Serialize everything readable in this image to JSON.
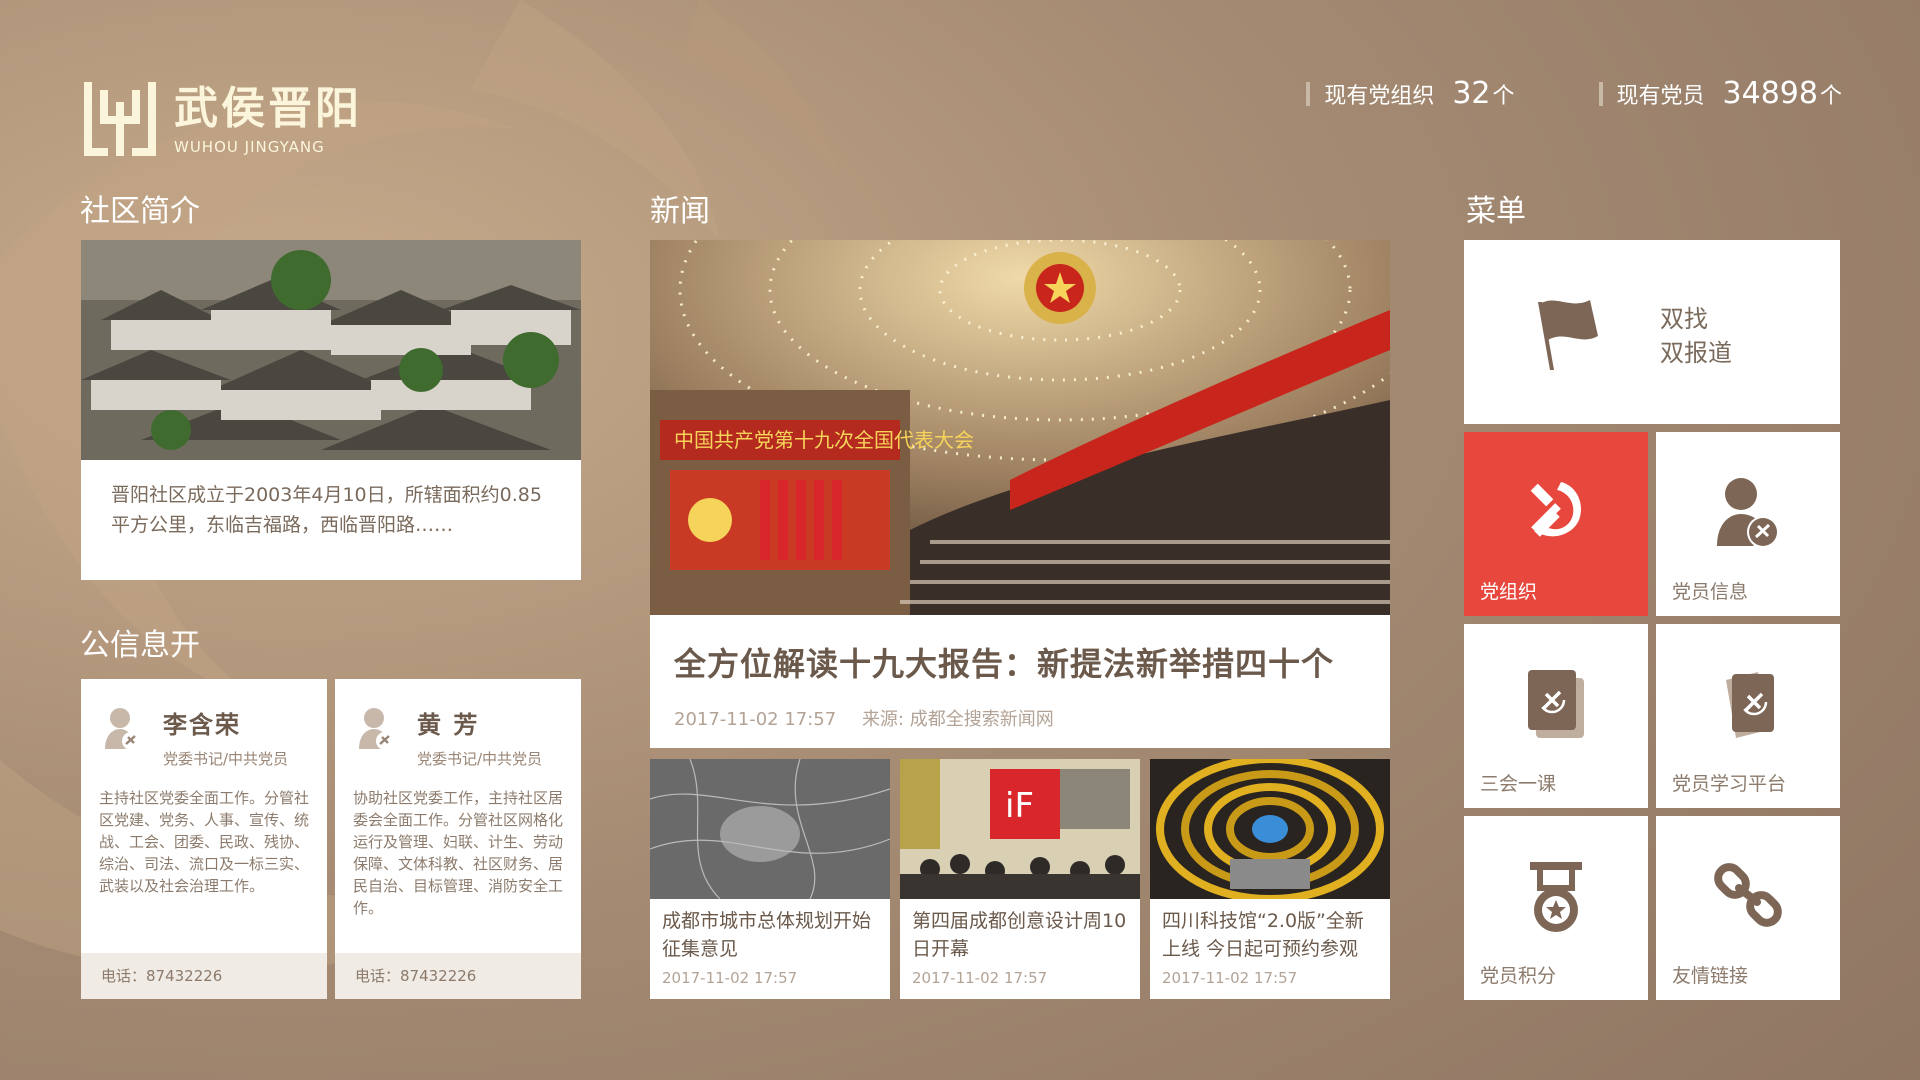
{
  "header": {
    "logo_cn": "武侯晋阳",
    "logo_en": "WUHOU JINGYANG",
    "stats": [
      {
        "label": "现有党组织",
        "value": "32",
        "unit": "个"
      },
      {
        "label": "现有党员",
        "value": "34898",
        "unit": "个"
      }
    ]
  },
  "sections": {
    "intro": "社区简介",
    "public_info": "公信息开",
    "news": "新闻",
    "menu": "菜单"
  },
  "intro": {
    "text": "晋阳社区成立于2003年4月10日，所辖面积约0.85平方公里，东临吉福路，西临晋阳路……"
  },
  "staff": [
    {
      "name": "李含荣",
      "role": "党委书记/中共党员",
      "desc": "主持社区党委全面工作。分管社区党建、党务、人事、宣传、统战、工会、团委、民政、残协、综治、司法、流口及一标三实、武装以及社会治理工作。",
      "phone": "电话：87432226"
    },
    {
      "name": "黄  芳",
      "role": "党委书记/中共党员",
      "desc": "协助社区党委工作，主持社区居委会全面工作。分管社区网格化运行及管理、妇联、计生、劳动保障、文体科教、社区财务、居民自治、目标管理、消防安全工作。",
      "phone": "电话：87432226"
    }
  ],
  "news": {
    "main": {
      "title": "全方位解读十九大报告：新提法新举措四十个",
      "time": "2017-11-02 17:57",
      "source": "来源: 成都全搜索新闻网",
      "banner_text": "中国共产党第十九次全国代表大会"
    },
    "items": [
      {
        "title": "成都市城市总体规划开始征集意见",
        "time": "2017-11-02 17:57"
      },
      {
        "title": "第四届成都创意设计周10日开幕",
        "time": "2017-11-02 17:57"
      },
      {
        "title": "四川科技馆“2.0版”全新上线 今日起可预约参观",
        "time": "2017-11-02 17:57"
      }
    ]
  },
  "menu": {
    "main": {
      "line1": "双找",
      "line2": "双报道",
      "icon": "flag-icon"
    },
    "tiles": [
      {
        "label": "党组织",
        "icon": "party-emblem-icon",
        "active": true
      },
      {
        "label": "党员信息",
        "icon": "member-info-icon",
        "active": false
      },
      {
        "label": "三会一课",
        "icon": "meeting-books-icon",
        "active": false
      },
      {
        "label": "党员学习平台",
        "icon": "study-platform-icon",
        "active": false
      },
      {
        "label": "党员积分",
        "icon": "medal-icon",
        "active": false
      },
      {
        "label": "友情链接",
        "icon": "link-icon",
        "active": false
      }
    ]
  },
  "colors": {
    "background": "#a08670",
    "accent_red": "#e8473d",
    "text_brown": "#6b5a4c",
    "icon_brown": "#7d6656",
    "logo_cream": "#fbf5dc"
  }
}
